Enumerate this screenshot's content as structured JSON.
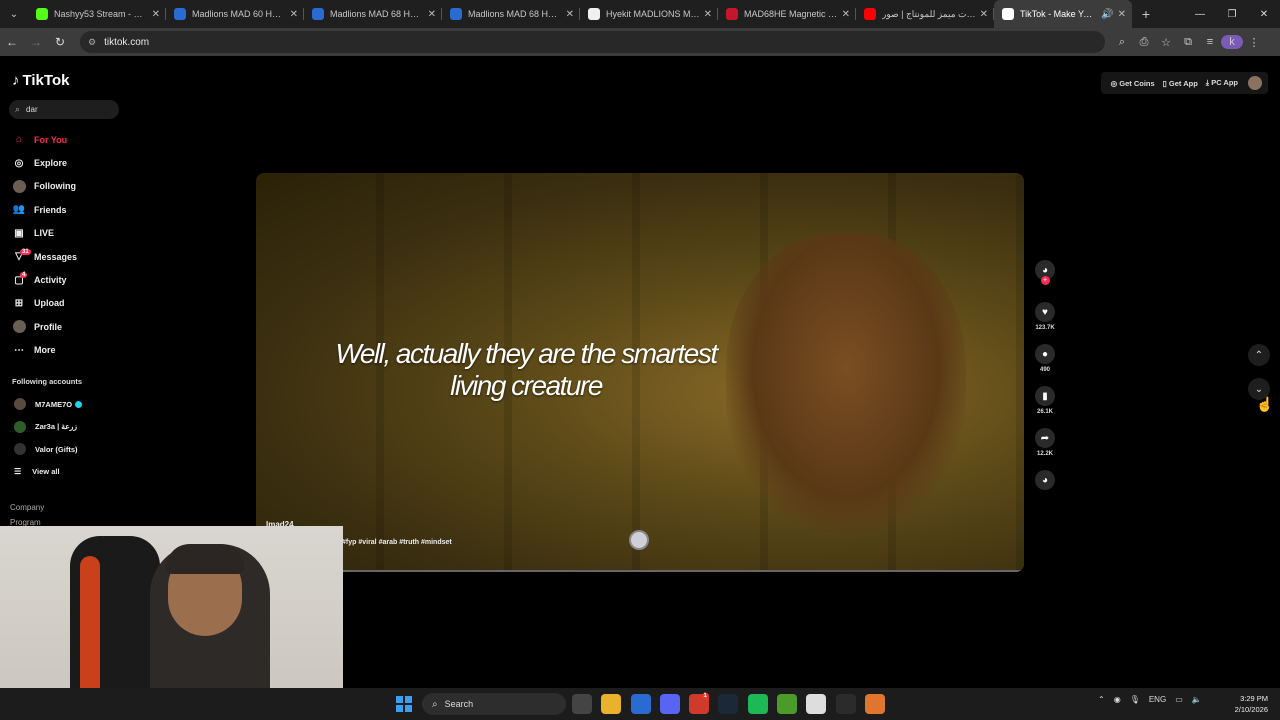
{
  "browser": {
    "tabs": [
      {
        "title": "Nashyy53 Stream - Watch",
        "icon": "kick-icon",
        "color": "#53fc18",
        "active": false
      },
      {
        "title": "Madlions MAD 60 HE Fla",
        "icon": "madlions-icon",
        "color": "#2a6bd1",
        "active": false
      },
      {
        "title": "Madlions MAD 68 HE Gar",
        "icon": "madlions-icon",
        "color": "#2a6bd1",
        "active": false
      },
      {
        "title": "Madlions MAD 68 HE V2",
        "icon": "madlions-icon",
        "color": "#2a6bd1",
        "active": false
      },
      {
        "title": "Hyekit MADLIONS MAD 6",
        "icon": "hyekit-icon",
        "color": "#f0f0f0",
        "active": false
      },
      {
        "title": "MAD68HE Magnetic Gam",
        "icon": "red-icon",
        "color": "#c4172c",
        "active": false
      },
      {
        "title": "اصوات ميمز للمونتاج | صور",
        "icon": "youtube-icon",
        "color": "#ff0000",
        "active": false
      },
      {
        "title": "TikTok - Make Your D",
        "icon": "tiktok-icon",
        "color": "#ffffff",
        "active": true
      }
    ],
    "url": "tiktok.com",
    "profile_initial": "k"
  },
  "tiktok": {
    "logo": "TikTok",
    "search_value": "dar",
    "nav": [
      {
        "label": "For You",
        "icon": "home-icon",
        "active": true
      },
      {
        "label": "Explore",
        "icon": "compass-icon"
      },
      {
        "label": "Following",
        "icon": "following-avatar-icon"
      },
      {
        "label": "Friends",
        "icon": "friends-icon"
      },
      {
        "label": "LIVE",
        "icon": "live-icon"
      },
      {
        "label": "Messages",
        "icon": "messages-icon",
        "badge": "31"
      },
      {
        "label": "Activity",
        "icon": "activity-icon",
        "badge": "4"
      },
      {
        "label": "Upload",
        "icon": "upload-icon"
      },
      {
        "label": "Profile",
        "icon": "profile-avatar-icon"
      },
      {
        "label": "More",
        "icon": "more-icon"
      }
    ],
    "following_title": "Following accounts",
    "following_accounts": [
      {
        "name": "M7AME7O",
        "verified": true,
        "color": "#5a4a3e"
      },
      {
        "name": "Zar3a | زرعة",
        "verified": false,
        "color": "#2e5d2a"
      },
      {
        "name": "Valor (Gifts)",
        "verified": false,
        "color": "#333333"
      }
    ],
    "view_all": "View all",
    "footer": [
      "Company",
      "Program"
    ],
    "top_buttons": [
      "Get Coins",
      "Get App",
      "PC App"
    ],
    "video": {
      "caption_line1": "Well, actually they are the smartest",
      "caption_line2": "living creature",
      "author": "Imad24",
      "hashtags": "#fyp #viral #arab #truth #mindset"
    },
    "actions": [
      {
        "name": "like",
        "icon": "heart-icon",
        "count": "123.7K"
      },
      {
        "name": "comment",
        "icon": "comment-icon",
        "count": "490"
      },
      {
        "name": "save",
        "icon": "bookmark-icon",
        "count": "26.1K"
      },
      {
        "name": "share",
        "icon": "share-icon",
        "count": "12.2K"
      }
    ]
  },
  "taskbar": {
    "search_placeholder": "Search",
    "language": "ENG",
    "time": "3:29 PM",
    "date": "2/10/2026",
    "apps": [
      {
        "name": "task-view",
        "color": "#444444"
      },
      {
        "name": "file-explorer",
        "color": "#e8b22c"
      },
      {
        "name": "store",
        "color": "#2a6bd1"
      },
      {
        "name": "discord",
        "color": "#5865f2"
      },
      {
        "name": "red-app",
        "color": "#d03a2a"
      },
      {
        "name": "steam",
        "color": "#1b2838"
      },
      {
        "name": "spotify",
        "color": "#1db954"
      },
      {
        "name": "utorrent",
        "color": "#4c9a2a"
      },
      {
        "name": "chrome",
        "color": "#dddddd"
      },
      {
        "name": "obs",
        "color": "#2b2b2b"
      },
      {
        "name": "recorder",
        "color": "#e0752d"
      }
    ],
    "app_badges": {
      "discord": "",
      "red-app": "1"
    }
  }
}
